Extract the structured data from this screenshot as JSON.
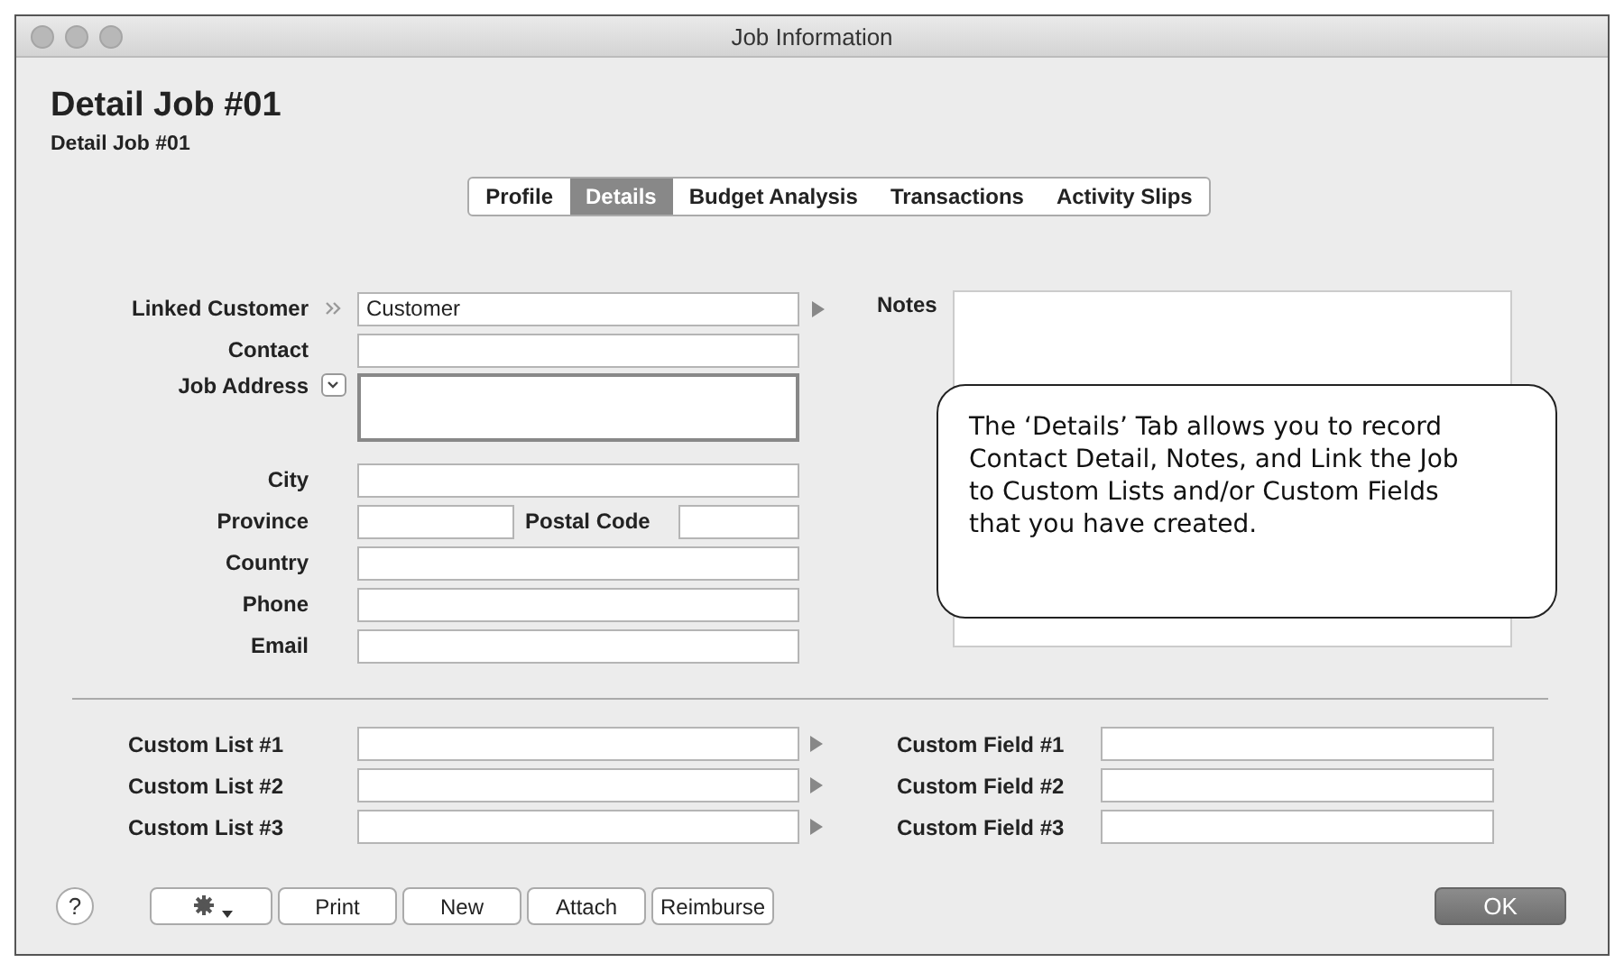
{
  "window": {
    "title": "Job Information"
  },
  "heading": "Detail Job #01",
  "subheading": "Detail Job #01",
  "tabs": [
    {
      "label": "Profile",
      "selected": false
    },
    {
      "label": "Details",
      "selected": true
    },
    {
      "label": "Budget Analysis",
      "selected": false
    },
    {
      "label": "Transactions",
      "selected": false
    },
    {
      "label": "Activity Slips",
      "selected": false
    }
  ],
  "fields": [
    {
      "kind": "link",
      "label": "Linked Customer",
      "value": "Customer"
    },
    {
      "kind": "text",
      "label": "Contact"
    },
    {
      "kind": "address",
      "label": "Job Address"
    },
    {
      "kind": "text",
      "label": "City"
    },
    {
      "kind": "split",
      "label": "Province",
      "label_2": "Postal Code"
    },
    {
      "kind": "text",
      "label": "Country"
    },
    {
      "kind": "text",
      "label": "Phone"
    },
    {
      "kind": "text",
      "label": "Email"
    }
  ],
  "notes": {
    "label": "Notes"
  },
  "callout": "The ‘Details’ Tab allows you to record Contact Detail, Notes, and Link the Job to Custom Lists and/or Custom Fields that you have created.",
  "custom_lists": [
    {
      "label": "Custom List #1"
    },
    {
      "label": "Custom List #2"
    },
    {
      "label": "Custom List #3"
    }
  ],
  "custom_fields": [
    {
      "label": "Custom Field #1"
    },
    {
      "label": "Custom Field #2"
    },
    {
      "label": "Custom Field #3"
    }
  ],
  "help": "?",
  "buttons": [
    "Print",
    "New",
    "Attach",
    "Reimburse"
  ],
  "ok": "OK"
}
